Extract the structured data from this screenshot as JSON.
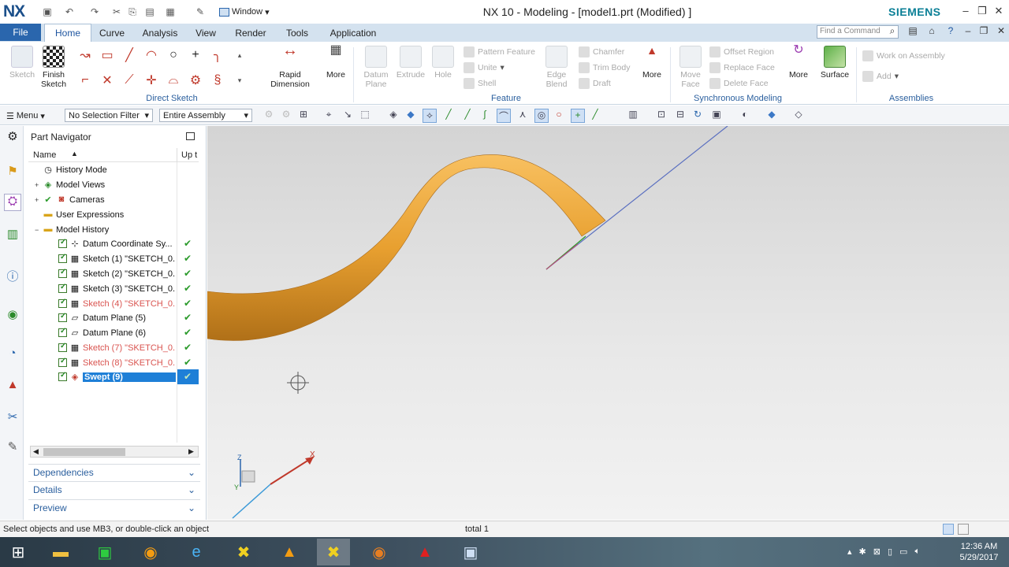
{
  "app": {
    "logo": "NX",
    "window_menu": "Window",
    "title": "NX 10 - Modeling - [model1.prt (Modified) ]",
    "brand": "SIEMENS"
  },
  "ribbon_tabs": [
    "File",
    "Home",
    "Curve",
    "Analysis",
    "View",
    "Render",
    "Tools",
    "Application"
  ],
  "active_tab": "Home",
  "command_search": {
    "placeholder": "Find a Command"
  },
  "ribbon": {
    "sketch": "Sketch",
    "finish_sketch": "Finish Sketch",
    "rapid_dimension": "Rapid Dimension",
    "more": "More",
    "datum_plane": "Datum Plane",
    "extrude": "Extrude",
    "hole": "Hole",
    "pattern_feature": "Pattern Feature",
    "unite": "Unite",
    "shell": "Shell",
    "edge_blend": "Edge Blend",
    "chamfer": "Chamfer",
    "trim_body": "Trim Body",
    "draft": "Draft",
    "move_face": "Move Face",
    "offset_region": "Offset Region",
    "replace_face": "Replace Face",
    "delete_face": "Delete Face",
    "surface": "Surface",
    "work_on_assembly": "Work on Assembly",
    "add": "Add",
    "groups": {
      "direct_sketch": "Direct Sketch",
      "feature": "Feature",
      "synchronous_modeling": "Synchronous Modeling",
      "assemblies": "Assemblies"
    }
  },
  "topbar": {
    "menu": "Menu",
    "selection_filter": "No Selection Filter",
    "scope": "Entire Assembly"
  },
  "navigator": {
    "title": "Part Navigator",
    "col_name": "Name",
    "col_up": "Up t",
    "rows": [
      {
        "label": "History Mode"
      },
      {
        "label": "Model Views"
      },
      {
        "label": "Cameras"
      },
      {
        "label": "User Expressions"
      },
      {
        "label": "Model History"
      },
      {
        "label": "Datum Coordinate Sy..."
      },
      {
        "label": "Sketch (1) \"SKETCH_0..."
      },
      {
        "label": "Sketch (2) \"SKETCH_0..."
      },
      {
        "label": "Sketch (3) \"SKETCH_0..."
      },
      {
        "label": "Sketch (4) \"SKETCH_0..."
      },
      {
        "label": "Datum Plane (5)"
      },
      {
        "label": "Datum Plane (6)"
      },
      {
        "label": "Sketch (7) \"SKETCH_0..."
      },
      {
        "label": "Sketch (8) \"SKETCH_0..."
      },
      {
        "label": "Swept (9)"
      }
    ],
    "sections": [
      "Dependencies",
      "Details",
      "Preview"
    ]
  },
  "status": {
    "left": "Select objects and use MB3, or double-click an object",
    "center": "total 1"
  },
  "clock": {
    "time": "12:36 AM",
    "date": "5/29/2017"
  },
  "colors": {
    "accent": "#2a66ad",
    "swept_body": "#e8a030",
    "selection": "#1e7fd7"
  }
}
